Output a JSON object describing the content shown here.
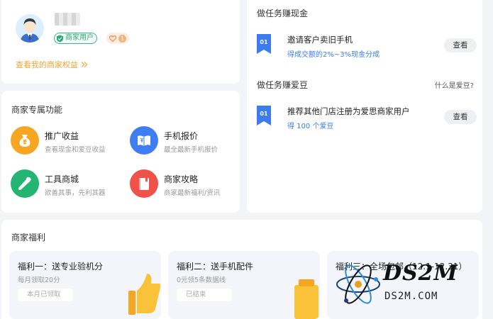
{
  "profile": {
    "merchant_badge": "商家用户",
    "heart_count": "1",
    "rights_link": "查看我的商家权益"
  },
  "features": {
    "title": "商家专属功能",
    "items": [
      {
        "title": "推广收益",
        "desc": "查看现金和爱豆收益",
        "icon": "money-bag-icon",
        "color": "#f6a623"
      },
      {
        "title": "手机报价",
        "desc": "最全最新手机报价",
        "icon": "price-book-icon",
        "color": "#3f7ef2"
      },
      {
        "title": "工具商城",
        "desc": "欲善其事，先利其器",
        "icon": "wrench-icon",
        "color": "#22b573"
      },
      {
        "title": "商家攻略",
        "desc": "商家最新福利/资讯",
        "icon": "guide-book-icon",
        "color": "#f0524a"
      }
    ]
  },
  "tasks": {
    "cash_title": "做任务赚现金",
    "bean_title": "做任务赚爱豆",
    "what_is_bean": "什么是爱豆?",
    "cash_task": {
      "index": "01",
      "title": "邀请客户卖旧手机",
      "desc": "得成交额的2%~3%现金分成",
      "button": "查看"
    },
    "bean_task": {
      "index": "01",
      "title": "推荐其他门店注册为爱思商家用户",
      "desc": "得 100 个爱豆",
      "button": "查看"
    }
  },
  "welfare": {
    "title": "商家福利",
    "items": [
      {
        "title": "福利一：送专业验机分",
        "sub": "每月领取20分",
        "button": "本月已领取"
      },
      {
        "title": "福利二：送手机配件",
        "sub": "0元领5条数据线",
        "button": "已结束"
      },
      {
        "title": "福利三：全场包邮（12.1-12.31）",
        "sub": "",
        "button": ""
      }
    ]
  },
  "watermark": {
    "main": "DS2M",
    "sub": "DS2M.COM"
  },
  "colors": {
    "accent_blue": "#3d7cf0",
    "accent_orange": "#f2a633",
    "green": "#2fa877"
  }
}
